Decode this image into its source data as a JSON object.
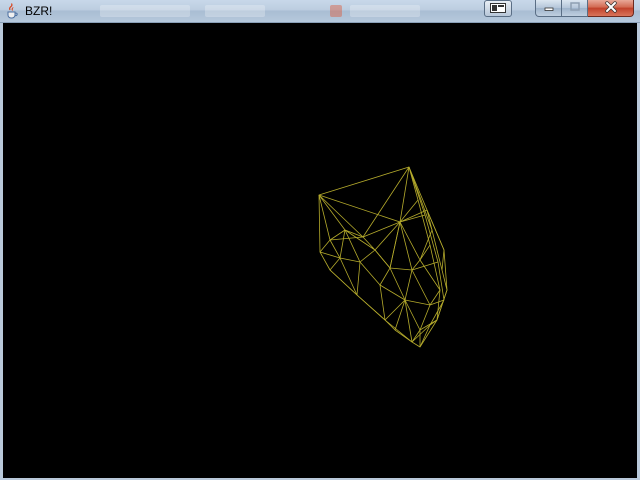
{
  "window": {
    "title": "BZR!",
    "app_icon": "java-cup-icon",
    "controls": {
      "switch_icon": "window-switch-icon",
      "minimize_icon": "minimize-icon",
      "maximize_icon": "maximize-icon",
      "close_icon": "close-icon"
    }
  },
  "scene": {
    "background_color": "#000000",
    "wireframe_color": "#b5ab2c",
    "object": "wireframe-mesh"
  }
}
